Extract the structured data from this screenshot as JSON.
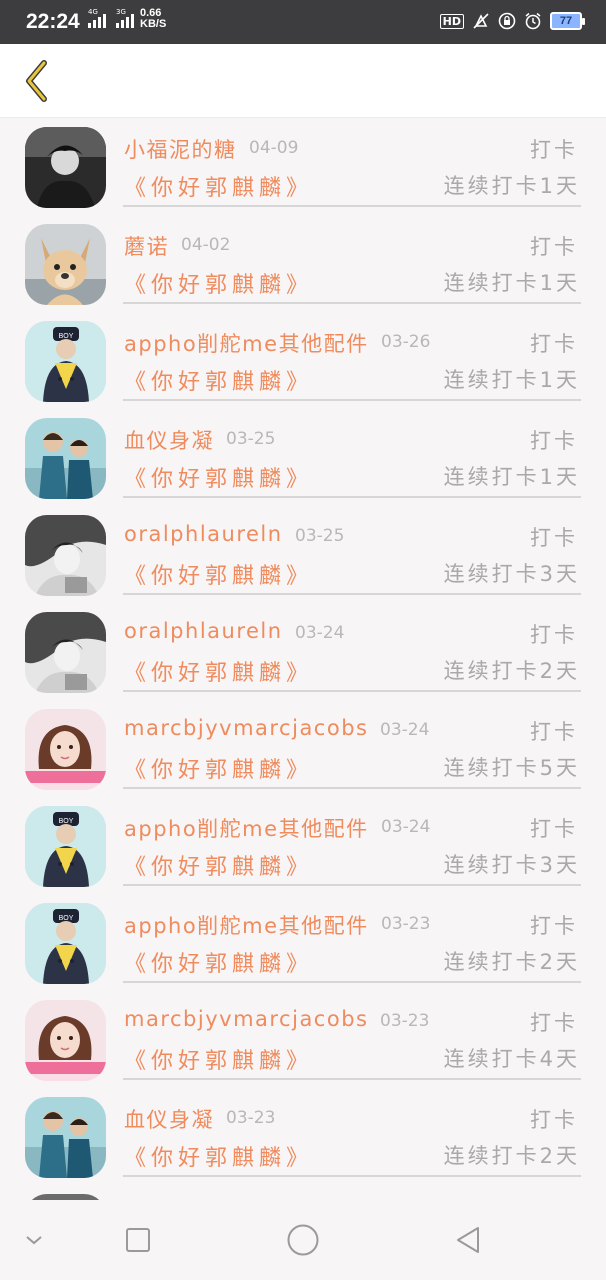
{
  "status_bar": {
    "time": "22:24",
    "signal1_label": "4G",
    "signal2_label": "3G",
    "speed_value": "0.66",
    "speed_unit": "KB/S",
    "hd_label": "HD",
    "battery": "77"
  },
  "icons": {
    "back": "chevron-left-icon",
    "nav": [
      "chevron-down-icon",
      "square-icon",
      "circle-icon",
      "triangle-left-icon"
    ]
  },
  "colors": {
    "accent": "#ef8b5d",
    "muted": "#a9a9a9",
    "background": "#f7f5f6",
    "back_icon": "#e8c53c"
  },
  "records": [
    {
      "name": "小福泥的糖",
      "date": "04-09",
      "book": "《你好郭麒麟》",
      "action": "打卡",
      "streak": "连续打卡1天",
      "avatar": "boy-dark"
    },
    {
      "name": "蘑诺",
      "date": "04-02",
      "book": "《你好郭麒麟》",
      "action": "打卡",
      "streak": "连续打卡1天",
      "avatar": "puppy"
    },
    {
      "name": "appho削舵me其他配件",
      "date": "03-26",
      "book": "《你好郭麒麟》",
      "action": "打卡",
      "streak": "连续打卡1天",
      "avatar": "boy-cap"
    },
    {
      "name": "血仪身凝",
      "date": "03-25",
      "book": "《你好郭麒麟》",
      "action": "打卡",
      "streak": "连续打卡1天",
      "avatar": "two-kids"
    },
    {
      "name": "oralphlaureln",
      "date": "03-25",
      "book": "《你好郭麒麟》",
      "action": "打卡",
      "streak": "连续打卡3天",
      "avatar": "girl-bw"
    },
    {
      "name": "oralphlaureln",
      "date": "03-24",
      "book": "《你好郭麒麟》",
      "action": "打卡",
      "streak": "连续打卡2天",
      "avatar": "girl-bw"
    },
    {
      "name": "marcbjyvmarcjacobs",
      "date": "03-24",
      "book": "《你好郭麒麟》",
      "action": "打卡",
      "streak": "连续打卡5天",
      "avatar": "girl-pink"
    },
    {
      "name": "appho削舵me其他配件",
      "date": "03-24",
      "book": "《你好郭麒麟》",
      "action": "打卡",
      "streak": "连续打卡3天",
      "avatar": "boy-cap"
    },
    {
      "name": "appho削舵me其他配件",
      "date": "03-23",
      "book": "《你好郭麒麟》",
      "action": "打卡",
      "streak": "连续打卡2天",
      "avatar": "boy-cap"
    },
    {
      "name": "marcbjyvmarcjacobs",
      "date": "03-23",
      "book": "《你好郭麒麟》",
      "action": "打卡",
      "streak": "连续打卡4天",
      "avatar": "girl-pink"
    },
    {
      "name": "血仪身凝",
      "date": "03-23",
      "book": "《你好郭麒麟》",
      "action": "打卡",
      "streak": "连续打卡2天",
      "avatar": "two-kids"
    }
  ]
}
